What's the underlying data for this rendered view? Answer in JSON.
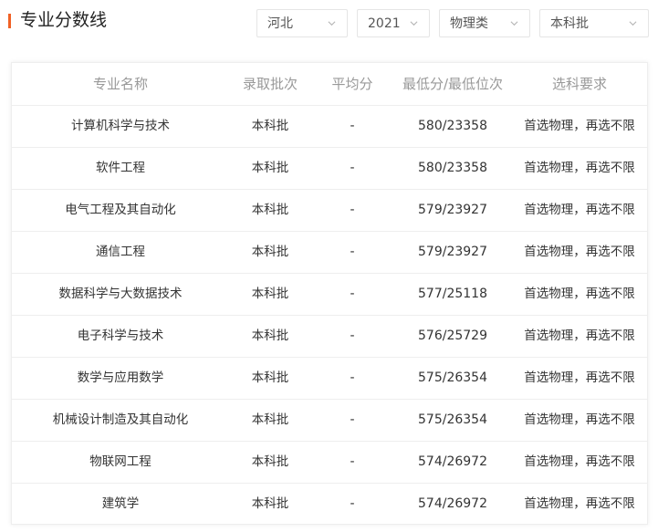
{
  "header": {
    "title": "专业分数线"
  },
  "filters": {
    "province": "河北",
    "year": "2021",
    "subject": "物理类",
    "batch": "本科批"
  },
  "table": {
    "columns": [
      "专业名称",
      "录取批次",
      "平均分",
      "最低分/最低位次",
      "选科要求"
    ],
    "rows": [
      [
        "计算机科学与技术",
        "本科批",
        "-",
        "580/23358",
        "首选物理，再选不限"
      ],
      [
        "软件工程",
        "本科批",
        "-",
        "580/23358",
        "首选物理，再选不限"
      ],
      [
        "电气工程及其自动化",
        "本科批",
        "-",
        "579/23927",
        "首选物理，再选不限"
      ],
      [
        "通信工程",
        "本科批",
        "-",
        "579/23927",
        "首选物理，再选不限"
      ],
      [
        "数据科学与大数据技术",
        "本科批",
        "-",
        "577/25118",
        "首选物理，再选不限"
      ],
      [
        "电子科学与技术",
        "本科批",
        "-",
        "576/25729",
        "首选物理，再选不限"
      ],
      [
        "数学与应用数学",
        "本科批",
        "-",
        "575/26354",
        "首选物理，再选不限"
      ],
      [
        "机械设计制造及其自动化",
        "本科批",
        "-",
        "575/26354",
        "首选物理，再选不限"
      ],
      [
        "物联网工程",
        "本科批",
        "-",
        "574/26972",
        "首选物理，再选不限"
      ],
      [
        "建筑学",
        "本科批",
        "-",
        "574/26972",
        "首选物理，再选不限"
      ]
    ]
  }
}
